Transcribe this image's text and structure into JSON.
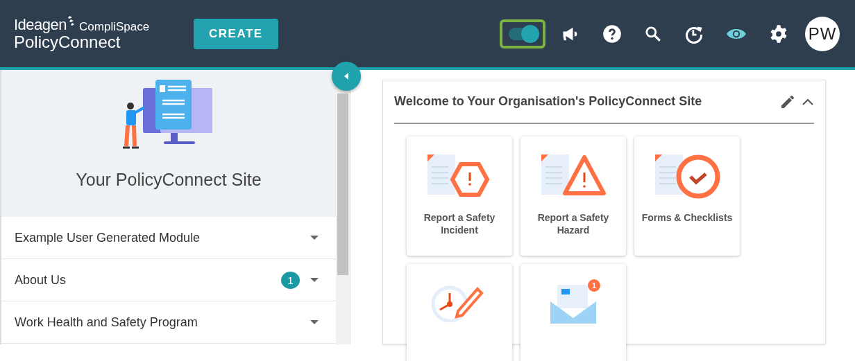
{
  "header": {
    "logo": {
      "brand": "Ideagen",
      "sub": "CompliSpace",
      "product": "PolicyConnect"
    },
    "create_button": "CREATE",
    "toggle": {
      "on": true,
      "highlighted": true
    },
    "avatar": "PW"
  },
  "sidebar": {
    "title": "Your PolicyConnect Site",
    "items": [
      {
        "label": "Example User Generated Module",
        "expanded": false
      },
      {
        "label": "About Us",
        "badge": "1",
        "expanded": false
      },
      {
        "label": "Work Health and Safety Program",
        "expanded": false
      }
    ]
  },
  "panel": {
    "title": "Welcome to Your Organisation's PolicyConnect Site",
    "expanded": true,
    "tiles": [
      {
        "kind": "incident",
        "label": "Report a Safety Incident"
      },
      {
        "kind": "hazard",
        "label": "Report a Safety Hazard"
      },
      {
        "kind": "checklist",
        "label": "Forms & Checklists"
      },
      {
        "kind": "clock"
      },
      {
        "kind": "mail",
        "badge": "1"
      }
    ]
  }
}
